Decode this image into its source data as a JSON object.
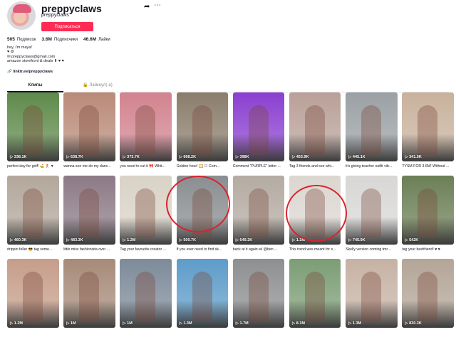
{
  "profile": {
    "username": "preppyclaws",
    "subname": "preppyclaws",
    "follow_label": "Подписаться",
    "stats": [
      {
        "value": "505",
        "label": "Подписок"
      },
      {
        "value": "3.6M",
        "label": "Подписчики"
      },
      {
        "value": "46.6M",
        "label": "Лайки"
      }
    ],
    "bio": [
      "hey, i'm maya!",
      "♥ ⚙",
      "✉ preppyclaws@gmail.com",
      "amazon storefront & deals ⬇ ♥ ♥"
    ],
    "link": "🔗 linktr.ee/preppyclaws",
    "icons": {
      "share": "share-icon",
      "more": "more-icon",
      "lock": "lock-icon"
    }
  },
  "tabs": {
    "clips": "Клипы",
    "likes": "🔒 Лайкнул(-а)"
  },
  "videos": [
    {
      "views": "▷ 338.1K",
      "caption": "perfect day for golf! ⛳ 🏌 ♥"
    },
    {
      "views": "▷ 638.7K",
      "caption": "wanna see me do my danc..."
    },
    {
      "views": "▷ 373.7K",
      "caption": "you need to cut it 🎀 Whit..."
    },
    {
      "views": "▷ 668.2K",
      "caption": "Golden hour! 🌅 ☐ Com..."
    },
    {
      "views": "▷ 398K",
      "caption": "Comment \"PURPLE\" letter ..."
    },
    {
      "views": "▷ 453.9K",
      "caption": "Tag 3 friends and see whi..."
    },
    {
      "views": "▷ 445.1K",
      "caption": "it's giving teacher outfit vib..."
    },
    {
      "views": "▷ 341.5K",
      "caption": "TYSM FOR 3.6M! Without ..."
    },
    {
      "views": "▷ 460.3K",
      "caption": "drippin feller 😎 tag some..."
    },
    {
      "views": "▷ 483.3K",
      "caption": "little miss fashionista over ..."
    },
    {
      "views": "▷ 1.2M",
      "caption": "Tag your favourite creator ..."
    },
    {
      "views": "▷ 500.7K",
      "caption": "If you ever need to find sk..."
    },
    {
      "views": "▷ 649.2K",
      "caption": "back at it again w/ @ben ..."
    },
    {
      "views": "▷ 1.1M",
      "caption": "This trend was meant for s..."
    },
    {
      "views": "▷ 745.9K",
      "caption": "Skelly version coming tmr..."
    },
    {
      "views": "▷ 542K",
      "caption": "tag your bestfriend! ♥ ♥"
    },
    {
      "views": "▷ 1.2M",
      "caption": ""
    },
    {
      "views": "▷ 1M",
      "caption": ""
    },
    {
      "views": "▷ 1M",
      "caption": ""
    },
    {
      "views": "▷ 1.3M",
      "caption": ""
    },
    {
      "views": "▷ 1.7M",
      "caption": ""
    },
    {
      "views": "▷ 8.1M",
      "caption": ""
    },
    {
      "views": "▷ 1.3M",
      "caption": ""
    },
    {
      "views": "▷ 830.3K",
      "caption": ""
    }
  ],
  "colors": {
    "accent": "#fe2c55",
    "annotation_circle": "#d9232f",
    "thumbs": [
      "#5f8a4a",
      "#b98a78",
      "#d2838f",
      "#8a7d6c",
      "#8a3fd0",
      "#b9a098",
      "#9aa0a4",
      "#c8b19c",
      "#b3a79b",
      "#8c7a86",
      "#d9d2c6",
      "#8a8e90",
      "#b4aba2",
      "#dcd6d0",
      "#d8d7d6",
      "#6b7f56",
      "#c69d8a",
      "#a78a78",
      "#7d8a99",
      "#5d9cc9",
      "#8d8f91",
      "#7b9d74",
      "#c6b2a4",
      "#b3a597"
    ]
  }
}
